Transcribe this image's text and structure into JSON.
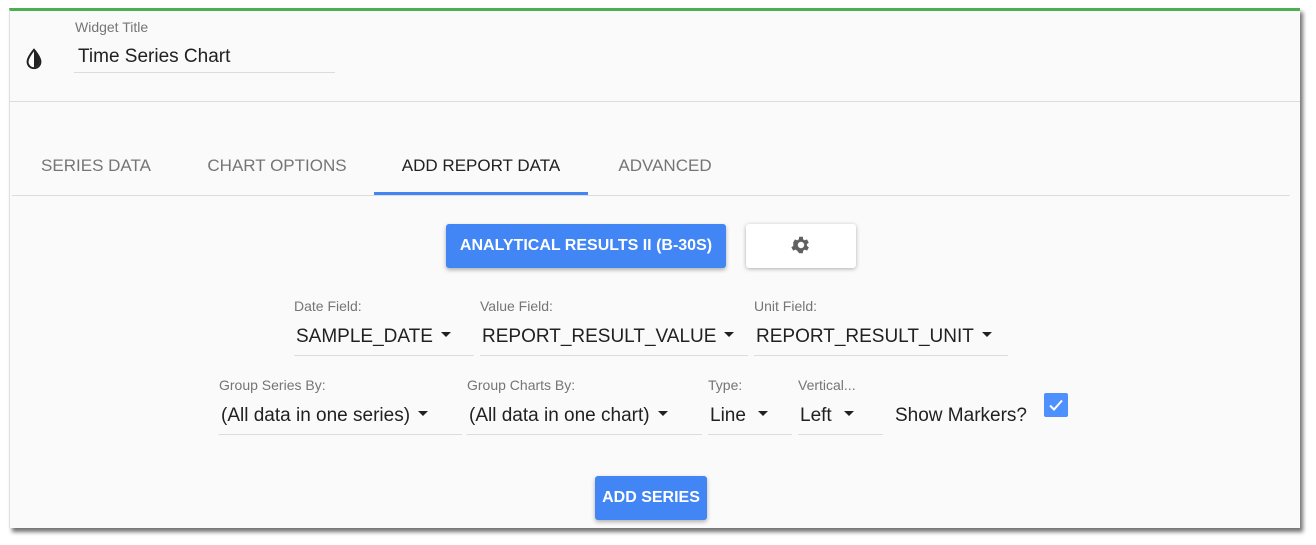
{
  "widget": {
    "title_label": "Widget Title",
    "title_value": "Time Series Chart",
    "icon": "invert-colors-icon",
    "accent_color": "#4caf50"
  },
  "tabs": [
    {
      "label": "SERIES DATA",
      "active": false
    },
    {
      "label": "CHART OPTIONS",
      "active": false
    },
    {
      "label": "ADD REPORT DATA",
      "active": true
    },
    {
      "label": "ADVANCED",
      "active": false
    }
  ],
  "report": {
    "button_label": "ANALYTICAL RESULTS II (B-30S)",
    "settings_icon": "gear-icon",
    "primary_color": "#4285f4"
  },
  "fields": {
    "date": {
      "label": "Date Field:",
      "value": "SAMPLE_DATE"
    },
    "value": {
      "label": "Value Field:",
      "value": "REPORT_RESULT_VALUE"
    },
    "unit": {
      "label": "Unit Field:",
      "value": "REPORT_RESULT_UNIT"
    },
    "group_series": {
      "label": "Group Series By:",
      "value": "(All data in one series)"
    },
    "group_charts": {
      "label": "Group Charts By:",
      "value": "(All data in one chart)"
    },
    "type": {
      "label": "Type:",
      "value": "Line"
    },
    "vertical": {
      "label": "Vertical...",
      "value": "Left"
    }
  },
  "show_markers": {
    "label": "Show Markers?",
    "checked": true
  },
  "add_series_label": "ADD SERIES"
}
